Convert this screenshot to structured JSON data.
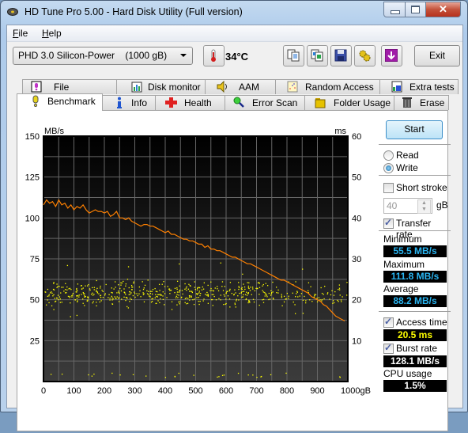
{
  "window": {
    "title": "HD Tune Pro 5.00 - Hard Disk Utility (Full version)",
    "controls": {
      "minimize": "—",
      "maximize": "□",
      "close": "✕"
    }
  },
  "menu": [
    {
      "label": "File",
      "accel": "F"
    },
    {
      "label": "Help",
      "accel": "H"
    }
  ],
  "toolbar": {
    "drive": "PHD 3.0 Silicon-Power    (1000 gB)",
    "temperature": "34°C",
    "buttons": [
      "copy-info-icon",
      "copy-screenshot-icon",
      "save-icon",
      "options-icon",
      "download-icon"
    ],
    "exit_label": "Exit"
  },
  "tabs": {
    "top_row": [
      {
        "label": "File Benchmark",
        "icon": "file-benchmark-icon"
      },
      {
        "label": "Disk monitor",
        "icon": "disk-monitor-icon"
      },
      {
        "label": "AAM",
        "icon": "speaker-icon"
      },
      {
        "label": "Random Access",
        "icon": "random-access-icon"
      },
      {
        "label": "Extra tests",
        "icon": "extra-tests-icon"
      }
    ],
    "bottom_row": [
      {
        "label": "Benchmark",
        "icon": "benchmark-icon",
        "active": true
      },
      {
        "label": "Info",
        "icon": "info-icon"
      },
      {
        "label": "Health",
        "icon": "health-cross-icon"
      },
      {
        "label": "Error Scan",
        "icon": "magnifier-icon"
      },
      {
        "label": "Folder Usage",
        "icon": "folder-icon"
      },
      {
        "label": "Erase",
        "icon": "trash-icon"
      }
    ]
  },
  "side": {
    "start_label": "Start",
    "read_label": "Read",
    "write_label": "Write",
    "mode": "Write",
    "short_stroke_label": "Short stroke",
    "short_stroke_checked": false,
    "short_stroke_value": "40",
    "short_stroke_unit": "gB",
    "transfer_rate_label": "Transfer rate",
    "transfer_rate_checked": true,
    "minimum_label": "Minimum",
    "minimum_value": "55.5 MB/s",
    "maximum_label": "Maximum",
    "maximum_value": "111.8 MB/s",
    "average_label": "Average",
    "average_value": "88.2 MB/s",
    "access_time_label": "Access time",
    "access_time_checked": true,
    "access_time_value": "20.5 ms",
    "burst_rate_label": "Burst rate",
    "burst_rate_checked": true,
    "burst_rate_value": "128.1 MB/s",
    "cpu_label": "CPU usage",
    "cpu_value": "1.5%"
  },
  "chart_data": {
    "type": "line",
    "title": "",
    "ylabel": "MB/s",
    "y2label": "ms",
    "xlabel": "gB",
    "xlim": [
      0,
      1000
    ],
    "ylim": [
      0,
      150
    ],
    "y2lim": [
      0,
      60
    ],
    "x_ticks": [
      "0",
      "100",
      "200",
      "300",
      "400",
      "500",
      "600",
      "700",
      "800",
      "900",
      "1000gB"
    ],
    "y_ticks": [
      "150",
      "125",
      "100",
      "75",
      "50",
      "25"
    ],
    "y2_ticks": [
      "60",
      "50",
      "40",
      "30",
      "20",
      "10"
    ],
    "grid": true,
    "colors": {
      "transfer": "#ff8000",
      "access": "#ffff00"
    },
    "series": [
      {
        "name": "Transfer rate (MB/s)",
        "axis": "left",
        "x": [
          0,
          10,
          20,
          30,
          40,
          50,
          60,
          70,
          80,
          90,
          100,
          110,
          120,
          130,
          140,
          150,
          160,
          170,
          180,
          190,
          200,
          210,
          220,
          230,
          240,
          250,
          260,
          270,
          280,
          290,
          300,
          310,
          320,
          330,
          340,
          350,
          360,
          370,
          380,
          390,
          400,
          410,
          420,
          430,
          440,
          450,
          460,
          470,
          480,
          490,
          500,
          510,
          520,
          530,
          540,
          550,
          560,
          570,
          580,
          590,
          600,
          610,
          620,
          630,
          640,
          650,
          660,
          670,
          680,
          690,
          700,
          710,
          720,
          730,
          740,
          750,
          760,
          770,
          780,
          790,
          800,
          810,
          820,
          830,
          840,
          850,
          860,
          870,
          880,
          890,
          900,
          910,
          920,
          930,
          940,
          950,
          960,
          970,
          980,
          990
        ],
        "values": [
          108,
          111,
          109,
          110,
          107,
          111,
          108,
          109,
          106,
          108,
          105,
          107,
          106,
          108,
          105,
          103,
          104,
          105,
          104,
          104,
          103,
          104,
          101,
          102,
          104,
          100,
          100,
          99,
          100,
          98,
          97,
          96,
          95,
          96,
          96,
          95,
          95,
          94,
          93,
          92,
          91,
          92,
          90,
          90,
          89,
          88,
          87,
          87,
          86,
          86,
          85,
          84,
          84,
          82,
          83,
          81,
          81,
          80,
          80,
          79,
          78,
          77,
          76,
          76,
          75,
          74,
          73,
          72,
          72,
          71,
          70,
          69,
          68,
          67,
          66,
          65,
          64,
          63,
          62,
          62,
          61,
          60,
          59,
          58,
          57,
          56,
          55,
          54,
          52,
          51,
          50,
          49,
          47,
          46,
          44,
          42,
          40,
          39,
          38,
          37
        ]
      },
      {
        "name": "Access time (ms)",
        "axis": "right",
        "type": "scatter",
        "cluster_center": 21.5,
        "cluster_spread": 2.5,
        "outliers_low": 1,
        "approx_point_count": 700
      }
    ]
  }
}
